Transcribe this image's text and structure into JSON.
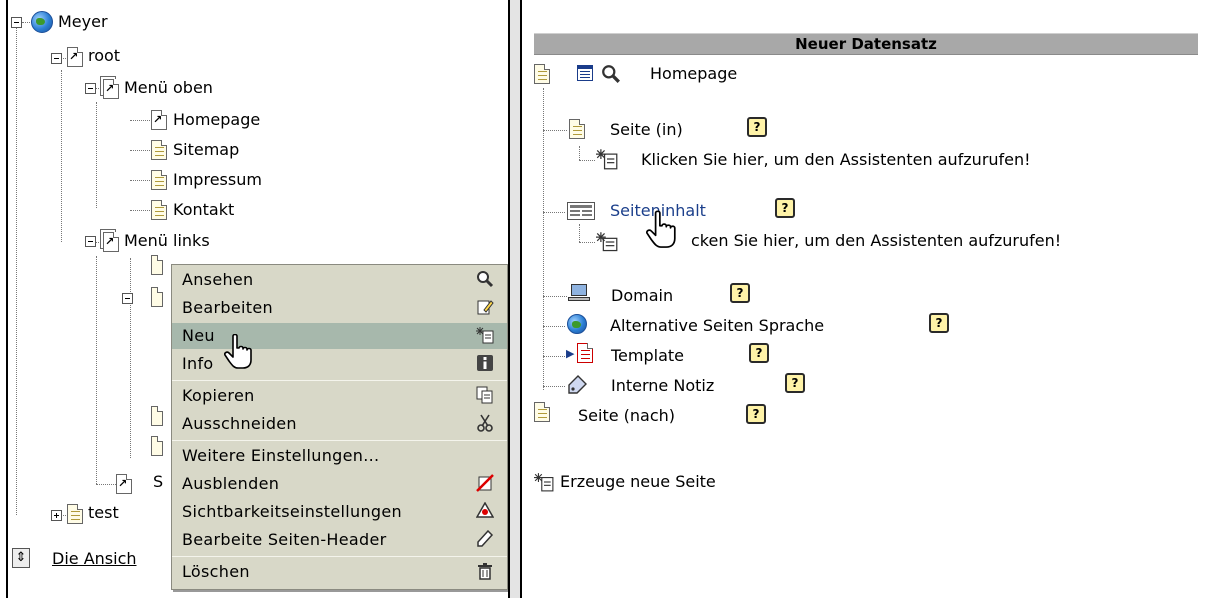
{
  "tree": {
    "root_site": "Meyer",
    "root_page": "root",
    "menu_top": "Menü oben",
    "menu_top_items": [
      "Homepage",
      "Sitemap",
      "Impressum",
      "Kontakt"
    ],
    "menu_left": "Menü links",
    "partial_item": "S",
    "partial_test": "test",
    "footer_link": "Die Ansich"
  },
  "context_menu": {
    "groups": [
      [
        {
          "label": "Ansehen",
          "icon": "magnifier-icon"
        },
        {
          "label": "Bearbeiten",
          "icon": "edit-page-icon"
        },
        {
          "label": "Neu",
          "icon": "new-record-icon",
          "active": true
        },
        {
          "label": "Info",
          "icon": "info-icon"
        }
      ],
      [
        {
          "label": "Kopieren",
          "icon": "copy-icon"
        },
        {
          "label": "Ausschneiden",
          "icon": "scissors-icon"
        }
      ],
      [
        {
          "label": "Weitere Einstellungen...",
          "icon": ""
        },
        {
          "label": "Ausblenden",
          "icon": "hide-icon"
        },
        {
          "label": "Sichtbarkeitseinstellungen",
          "icon": "visibility-icon"
        },
        {
          "label": "Bearbeite Seiten-Header",
          "icon": "page-header-icon"
        }
      ],
      [
        {
          "label": "Löschen",
          "icon": "trash-icon"
        }
      ]
    ]
  },
  "panel": {
    "header": "Neuer Datensatz",
    "page_title": "Homepage",
    "seite_in": "Seite (in)",
    "wizard_text": "Klicken Sie hier, um den Assistenten aufzurufen!",
    "content_link": "Seiteninhalt",
    "wizard_text_obscured": "cken Sie hier, um den Assistenten aufzurufen!",
    "domain": "Domain",
    "alt_lang": "Alternative Seiten Sprache",
    "template": "Template",
    "note": "Interne Notiz",
    "seite_nach": "Seite (nach)",
    "create_new": "Erzeuge neue Seite",
    "help_glyph": "?"
  }
}
